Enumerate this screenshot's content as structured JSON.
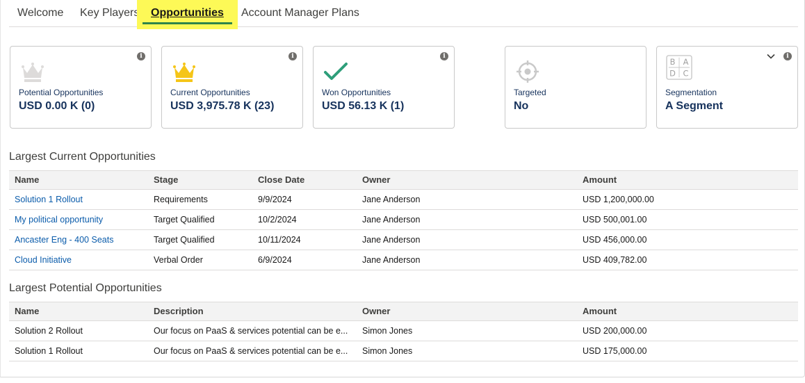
{
  "tabs": [
    {
      "label": "Welcome"
    },
    {
      "label": "Key Players"
    },
    {
      "label": "Opportunities",
      "active": true
    },
    {
      "label": "Account Manager Plans"
    }
  ],
  "cards": {
    "potential": {
      "label": "Potential Opportunities",
      "value": "USD 0.00 K (0)",
      "icon": "crown-icon-gray"
    },
    "current": {
      "label": "Current Opportunities",
      "value": "USD 3,975.78 K (23)",
      "icon": "crown-icon-gold"
    },
    "won": {
      "label": "Won Opportunities",
      "value": "USD 56.13 K (1)",
      "icon": "checkmark-icon"
    },
    "targeted": {
      "label": "Targeted",
      "value": "No",
      "icon": "target-icon"
    },
    "segmentation": {
      "label": "Segmentation",
      "value": "A Segment",
      "icon": "segment-grid-icon",
      "grid": [
        "B",
        "A",
        "D",
        "C"
      ]
    }
  },
  "current_section": {
    "title": "Largest Current Opportunities",
    "columns": [
      "Name",
      "Stage",
      "Close Date",
      "Owner",
      "Amount"
    ],
    "rows": [
      {
        "name": "Solution 1 Rollout",
        "stage": "Requirements",
        "close_date": "9/9/2024",
        "owner": "Jane Anderson",
        "amount": "USD 1,200,000.00"
      },
      {
        "name": "My political opportunity",
        "stage": "Target Qualified",
        "close_date": "10/2/2024",
        "owner": "Jane Anderson",
        "amount": "USD 500,001.00"
      },
      {
        "name": "Ancaster Eng - 400 Seats",
        "stage": "Target Qualified",
        "close_date": "10/11/2024",
        "owner": "Jane Anderson",
        "amount": "USD 456,000.00"
      },
      {
        "name": "Cloud Initiative",
        "stage": "Verbal Order",
        "close_date": "6/9/2024",
        "owner": "Jane Anderson",
        "amount": "USD 409,782.00"
      }
    ]
  },
  "potential_section": {
    "title": "Largest Potential Opportunities",
    "columns": [
      "Name",
      "Description",
      "Owner",
      "Amount"
    ],
    "rows": [
      {
        "name": "Solution 2 Rollout",
        "description": "Our focus on PaaS & services potential can be e...",
        "owner": "Simon Jones",
        "amount": "USD 200,000.00"
      },
      {
        "name": "Solution 1 Rollout",
        "description": "Our focus on PaaS & services potential can be e...",
        "owner": "Simon Jones",
        "amount": "USD 175,000.00"
      }
    ]
  },
  "colors": {
    "accent_tab_bg": "#fdf957",
    "tab_underline": "#2e844a",
    "link": "#0b5cab",
    "gold": "#f5c518",
    "check": "#2e9e7a"
  }
}
